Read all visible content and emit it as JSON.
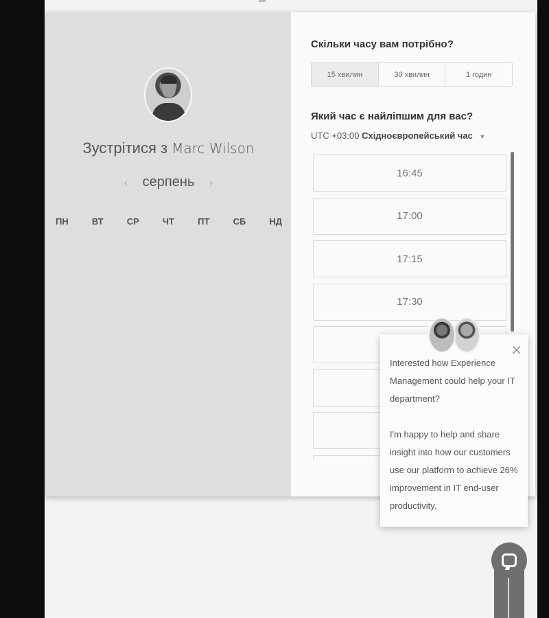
{
  "scheduler": {
    "title_prefix": "Зустрітися з",
    "host_name": "Marc Wilson",
    "month": {
      "prev_arrow": "‹",
      "label": "серпень",
      "next_arrow": "›"
    },
    "weekdays": [
      "ПН",
      "ВТ",
      "СР",
      "ЧТ",
      "ПТ",
      "СБ",
      "НД"
    ],
    "duration_question": "Скільки часу вам потрібно?",
    "durations": [
      {
        "label": "15 хвилин",
        "selected": true
      },
      {
        "label": "30 хвилин",
        "selected": false
      },
      {
        "label": "1 годин",
        "selected": false
      }
    ],
    "time_question": "Який час є найліпшим для вас?",
    "timezone": {
      "offset": "UTC +03:00",
      "name": "Східноєвропейський час"
    },
    "slots": [
      "16:45",
      "17:00",
      "17:15",
      "17:30",
      "",
      "",
      "",
      ""
    ]
  },
  "popup": {
    "paragraph1": "Interested how Experience Management could help your IT department?",
    "paragraph2": "I'm happy to help and share insight into how our customers use our platform to achieve 26% improvement in IT end-user productivity.",
    "close_symbol": "×"
  }
}
